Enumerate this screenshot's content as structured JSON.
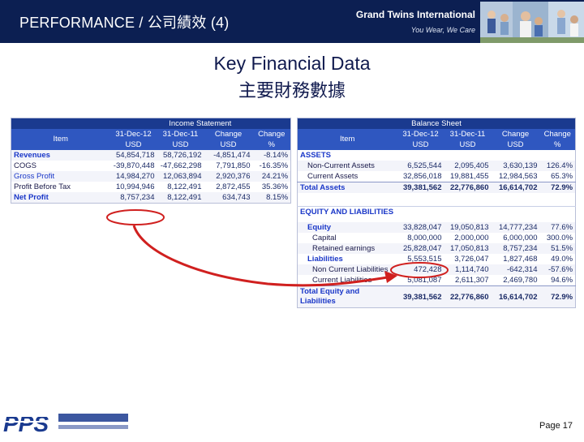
{
  "header": {
    "title": "PERFORMANCE / 公司績效 (4)",
    "company": "Grand Twins International",
    "tagline": "You Wear, We Care"
  },
  "main": {
    "title": "Key Financial Data",
    "subtitle": "主要財務數據"
  },
  "income_statement": {
    "band": "Income Statement",
    "headers": {
      "item": "Item",
      "c1": "31-Dec-12",
      "c1u": "USD",
      "c2": "31-Dec-11",
      "c2u": "USD",
      "c3": "Change",
      "c3u": "USD",
      "c4": "Change",
      "c4u": "%"
    },
    "rows": [
      {
        "label": "Revenues",
        "v1": "54,854,718",
        "v2": "58,726,192",
        "v3": "-4,851,474",
        "v4": "-8.14%"
      },
      {
        "label": "COGS",
        "v1": "-39,870,448",
        "v2": "-47,662,298",
        "v3": "7,791,850",
        "v4": "-16.35%"
      },
      {
        "label": "Gross Profit",
        "v1": "14,984,270",
        "v2": "12,063,894",
        "v3": "2,920,376",
        "v4": "24.21%"
      },
      {
        "label": "Profit Before Tax",
        "v1": "10,994,946",
        "v2": "8,122,491",
        "v3": "2,872,455",
        "v4": "35.36%"
      },
      {
        "label": "Net Profit",
        "v1": "8,757,234",
        "v2": "8,122,491",
        "v3": "634,743",
        "v4": "8.15%"
      }
    ]
  },
  "balance_sheet": {
    "band": "Balance Sheet",
    "headers": {
      "item": "Item",
      "c1": "31-Dec-12",
      "c1u": "USD",
      "c2": "31-Dec-11",
      "c2u": "USD",
      "c3": "Change",
      "c3u": "USD",
      "c4": "Change",
      "c4u": "%"
    },
    "assets_label": "ASSETS",
    "non_current_assets": {
      "label": "Non-Current Assets",
      "v1": "6,525,544",
      "v2": "2,095,405",
      "v3": "3,630,139",
      "v4": "126.4%"
    },
    "current_assets": {
      "label": "Current Assets",
      "v1": "32,856,018",
      "v2": "19,881,455",
      "v3": "12,984,563",
      "v4": "65.3%"
    },
    "total_assets": {
      "label": "Total Assets",
      "v1": "39,381,562",
      "v2": "22,776,860",
      "v3": "16,614,702",
      "v4": "72.9%"
    },
    "equity_liab_label": "EQUITY AND LIABILITIES",
    "equity": {
      "label": "Equity",
      "v1": "33,828,047",
      "v2": "19,050,813",
      "v3": "14,777,234",
      "v4": "77.6%"
    },
    "capital": {
      "label": "Capital",
      "v1": "8,000,000",
      "v2": "2,000,000",
      "v3": "6,000,000",
      "v4": "300.0%"
    },
    "retained": {
      "label": "Retained earnings",
      "v1": "25,828,047",
      "v2": "17,050,813",
      "v3": "8,757,234",
      "v4": "51.5%"
    },
    "liabilities": {
      "label": "Liabilities",
      "v1": "5,553,515",
      "v2": "3,726,047",
      "v3": "1,827,468",
      "v4": "49.0%"
    },
    "non_current_liab": {
      "label": "Non Current Liabilities",
      "v1": "472,428",
      "v2": "1,114,740",
      "v3": "-642,314",
      "v4": "-57.6%"
    },
    "current_liab": {
      "label": "Current Liabilities",
      "v1": "5,081,087",
      "v2": "2,611,307",
      "v3": "2,469,780",
      "v4": "94.6%"
    },
    "total_eq_liab": {
      "label": "Total Equity and Liabilities",
      "v1": "39,381,562",
      "v2": "22,776,860",
      "v3": "16,614,702",
      "v4": "72.9%"
    }
  },
  "footer": {
    "logo_text": "PPS",
    "page_label": "Page 17"
  },
  "colors": {
    "header_bg": "#0c1f52",
    "table_header": "#2f57c0",
    "highlight": "#d0201f"
  }
}
